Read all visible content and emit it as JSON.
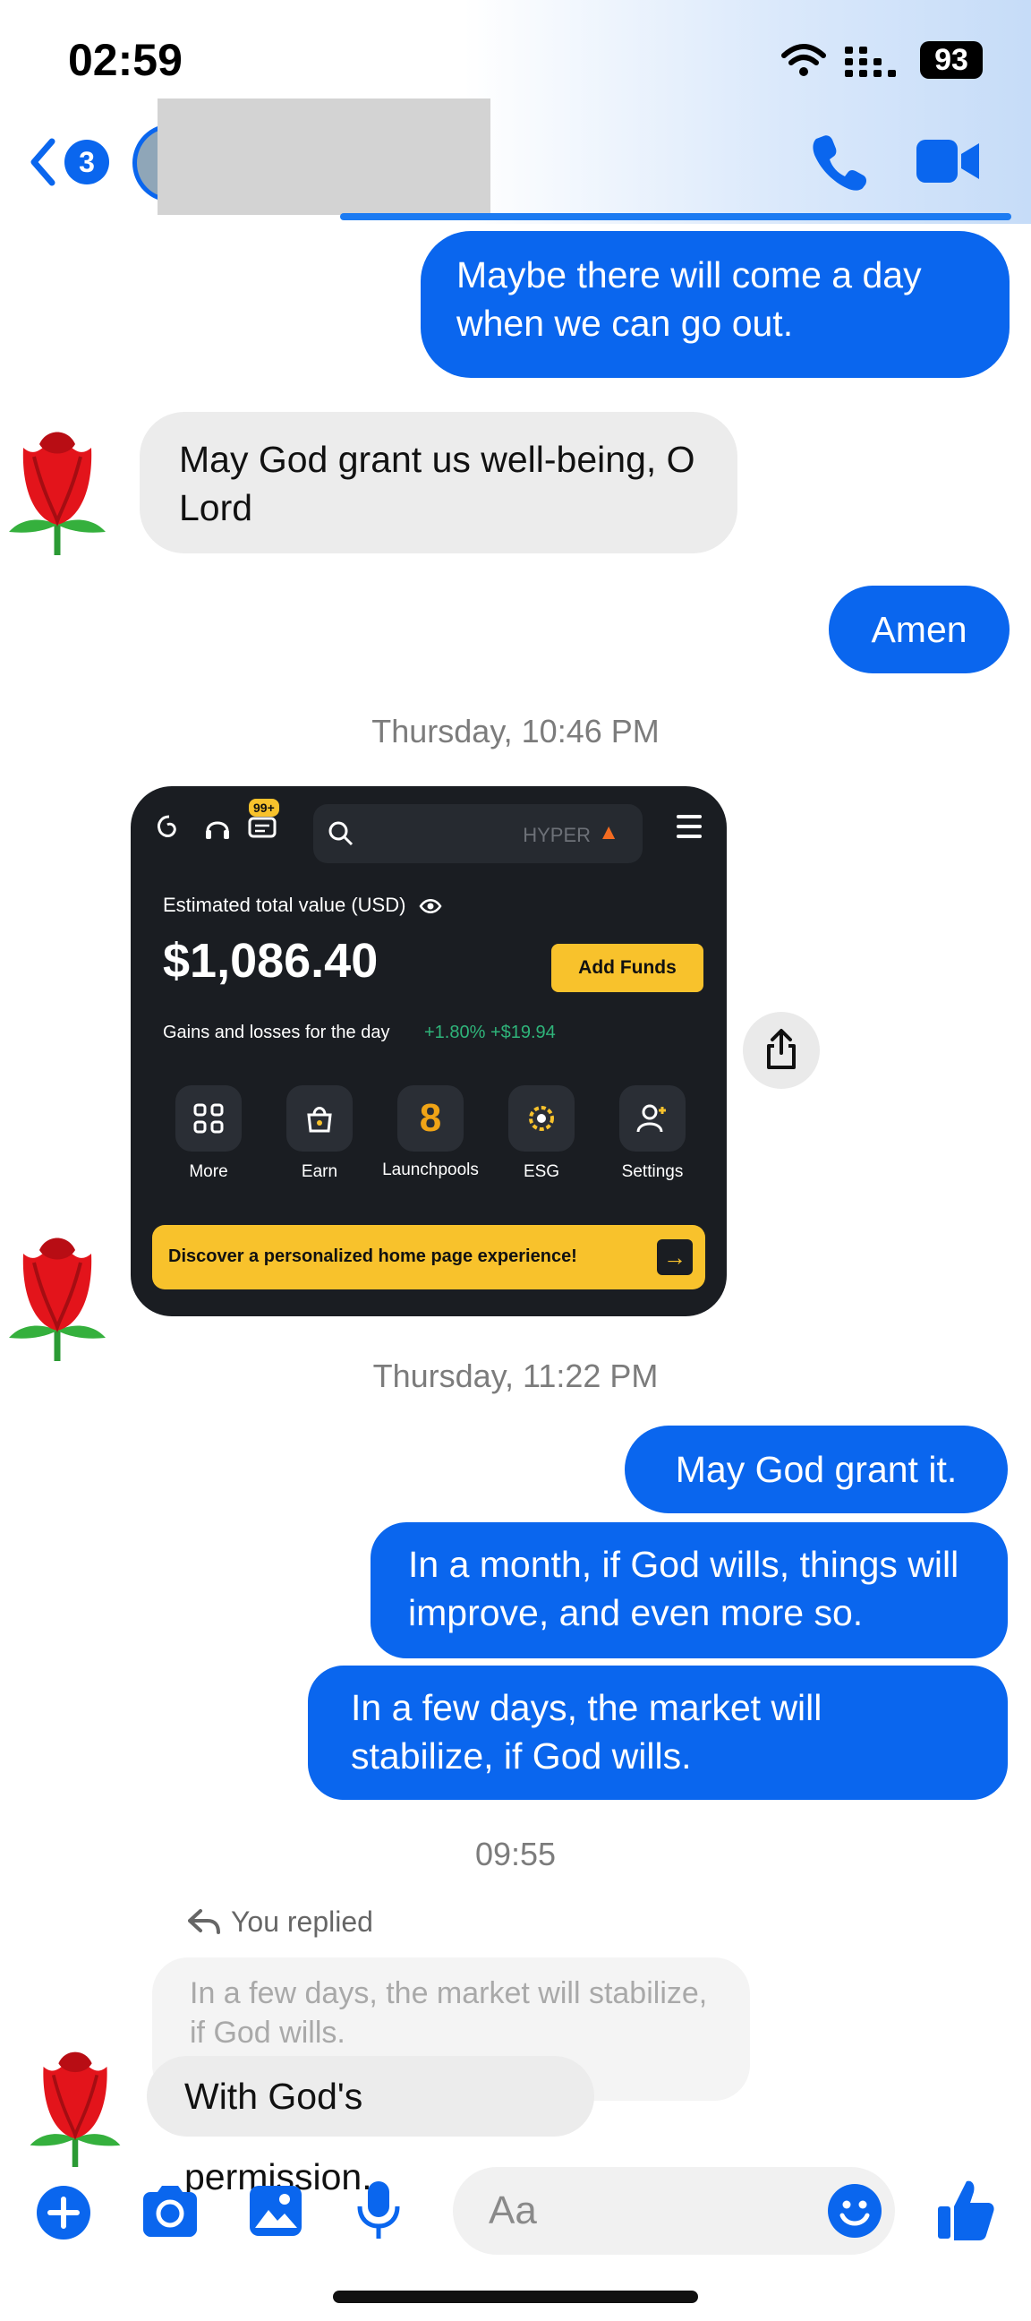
{
  "status_bar": {
    "time": "02:59",
    "battery": "93"
  },
  "header": {
    "unread_count": "3"
  },
  "messages": [
    {
      "side": "out",
      "text": "Maybe there will come a day when we can go out."
    },
    {
      "side": "in",
      "text": "May God grant us well-being, O Lord"
    },
    {
      "side": "out",
      "text": "Amen"
    }
  ],
  "timestamps": [
    "Thursday, 10:46 PM",
    "Thursday, 11:22 PM",
    "09:55"
  ],
  "shared_image": {
    "notification_badge": "99+",
    "search_hint": "HYPER",
    "estimated_label": "Estimated total value (USD)",
    "total_value": "$1,086.40",
    "add_funds": "Add Funds",
    "gains_label": "Gains and losses for the day",
    "gains_value": "+1.80% +$19.94",
    "tiles": [
      {
        "label": "More",
        "icon": "grid-icon"
      },
      {
        "label": "Earn",
        "icon": "bag-icon"
      },
      {
        "label": "Launchpools",
        "icon": "eight-icon",
        "glyph": "8"
      },
      {
        "label": "ESG",
        "icon": "gear-icon"
      },
      {
        "label": "Settings",
        "icon": "user-add-icon"
      }
    ],
    "banner": "Discover a personalized home page experience!"
  },
  "messages_2": [
    {
      "side": "out",
      "text": "May God grant it."
    },
    {
      "side": "out",
      "text": "In a month, if God wills, things will improve, and even more so."
    },
    {
      "side": "out",
      "text": "In a few days, the market will stabilize, if God wills."
    }
  ],
  "reply": {
    "label": "You replied",
    "quoted": "In a few days, the market will stabilize, if God wills.",
    "text": "With God's permission."
  },
  "composer": {
    "placeholder": "Aa"
  },
  "colors": {
    "accent": "#0a66ee",
    "incoming": "#ececec",
    "card_bg": "#1a1d22",
    "yellow": "#f8c22c"
  }
}
